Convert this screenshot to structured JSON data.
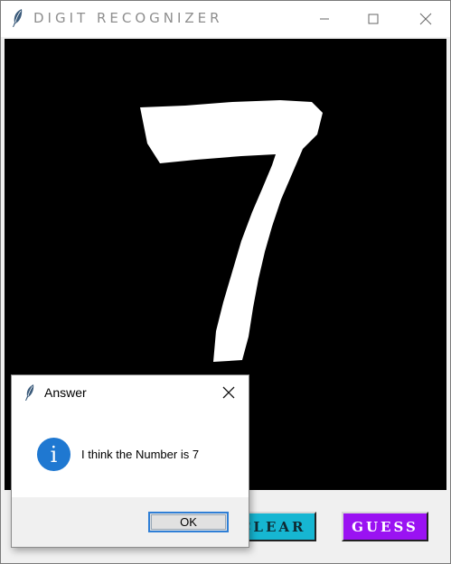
{
  "window": {
    "title": "DIGIT RECOGNIZER",
    "icons": {
      "app": "feather-icon",
      "minimize": "minimize-icon",
      "maximize": "maximize-icon",
      "close": "close-icon"
    }
  },
  "canvas": {
    "background": "#000000",
    "stroke_color": "#ffffff",
    "drawn_digit": "7"
  },
  "buttons": {
    "clear_label": "CLEAR",
    "guess_label": "GUESS",
    "clear_color": "#16b6d2",
    "guess_color": "#9a12f2"
  },
  "dialog": {
    "title": "Answer",
    "icon": "info-icon",
    "info_glyph": "i",
    "message": "I think the Number is 7",
    "ok_label": "OK"
  }
}
